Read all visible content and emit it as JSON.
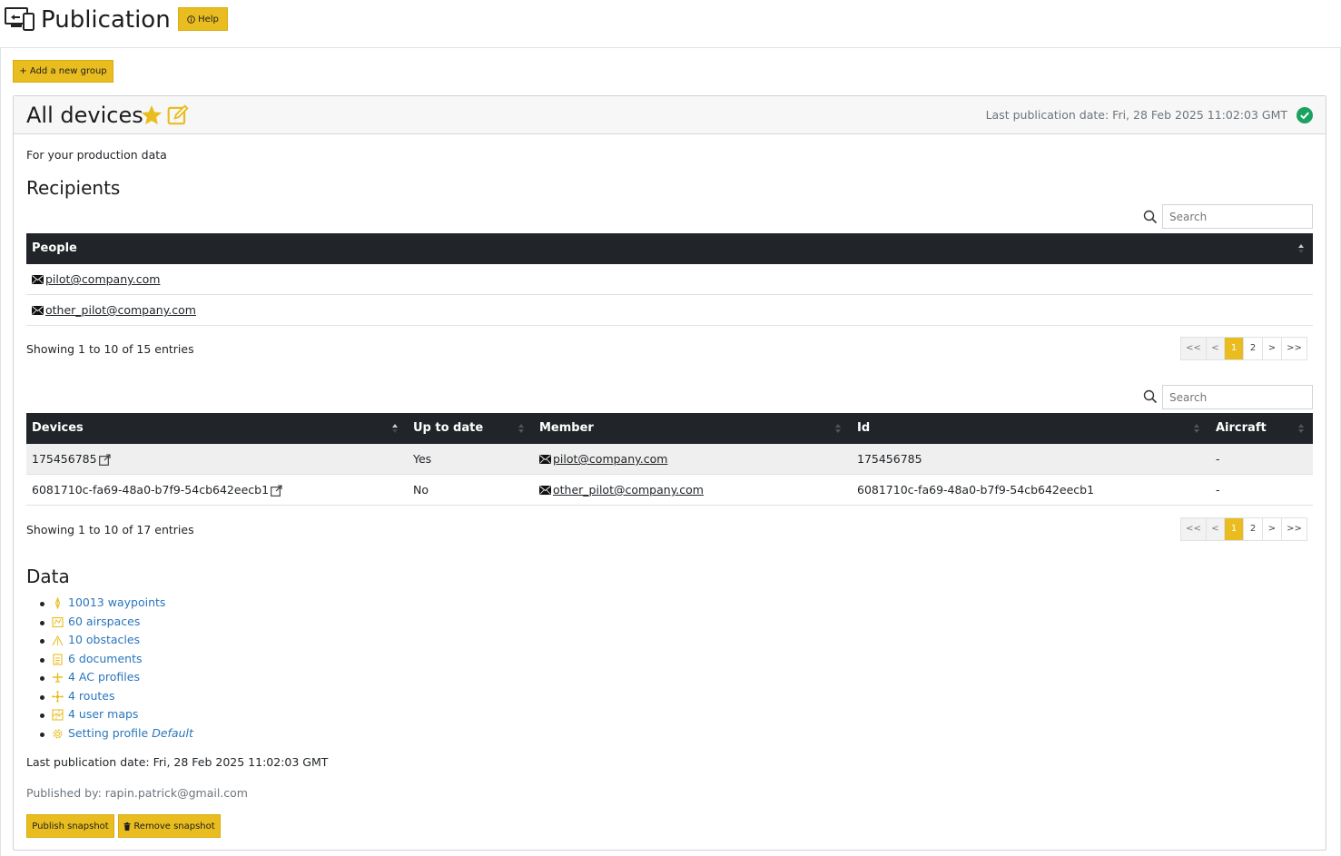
{
  "header": {
    "title": "Publication",
    "help_label": "Help",
    "logo_icon": "device-screens-icon"
  },
  "toolbar": {
    "add_group_label": "+ Add a new group"
  },
  "group": {
    "title": "All devices",
    "last_publication_top": "Last publication date: Fri, 28 Feb 2025 11:02:03 GMT",
    "description": "For your production data",
    "recipients_heading": "Recipients",
    "data_heading": "Data"
  },
  "recipients": {
    "search_placeholder": "Search",
    "column": "People",
    "rows": [
      "pilot@company.com",
      "other_pilot@company.com"
    ],
    "info": "Showing 1 to 10 of 15 entries",
    "pager": [
      "<<",
      "<",
      "1",
      "2",
      ">",
      ">>"
    ]
  },
  "devices": {
    "search_placeholder": "Search",
    "columns": [
      "Devices",
      "Up to date",
      "Member",
      "Id",
      "Aircraft"
    ],
    "rows": [
      {
        "device": "175456785",
        "up_to_date": "Yes",
        "member": "pilot@company.com",
        "id": "175456785",
        "aircraft": "-"
      },
      {
        "device": "6081710c-fa69-48a0-b7f9-54cb642eecb1",
        "up_to_date": "No",
        "member": "other_pilot@company.com",
        "id": "6081710c-fa69-48a0-b7f9-54cb642eecb1",
        "aircraft": "-"
      }
    ],
    "info": "Showing 1 to 10 of 17 entries",
    "pager": [
      "<<",
      "<",
      "1",
      "2",
      ">",
      ">>"
    ]
  },
  "data_items": [
    {
      "label": "10013 waypoints",
      "icon": "waypoint-icon"
    },
    {
      "label": "60 airspaces",
      "icon": "airspace-icon"
    },
    {
      "label": "10 obstacles",
      "icon": "obstacle-icon"
    },
    {
      "label": "6 documents",
      "icon": "document-icon"
    },
    {
      "label": "4 AC profiles",
      "icon": "aircraft-icon"
    },
    {
      "label": "4 routes",
      "icon": "route-icon"
    },
    {
      "label": "4 user maps",
      "icon": "map-icon"
    },
    {
      "label": "Setting profile ",
      "emphasis": "Default",
      "icon": "settings-icon"
    }
  ],
  "footer": {
    "last_publication": "Last publication date: Fri, 28 Feb 2025 11:02:03 GMT",
    "published_by": "Published by: rapin.patrick@gmail.com",
    "publish_label": "Publish snapshot",
    "remove_label": "Remove snapshot"
  },
  "colors": {
    "accent": "#e9bd1f",
    "link": "#2a76bd",
    "header_dark": "#212529",
    "success": "#1aa260"
  }
}
